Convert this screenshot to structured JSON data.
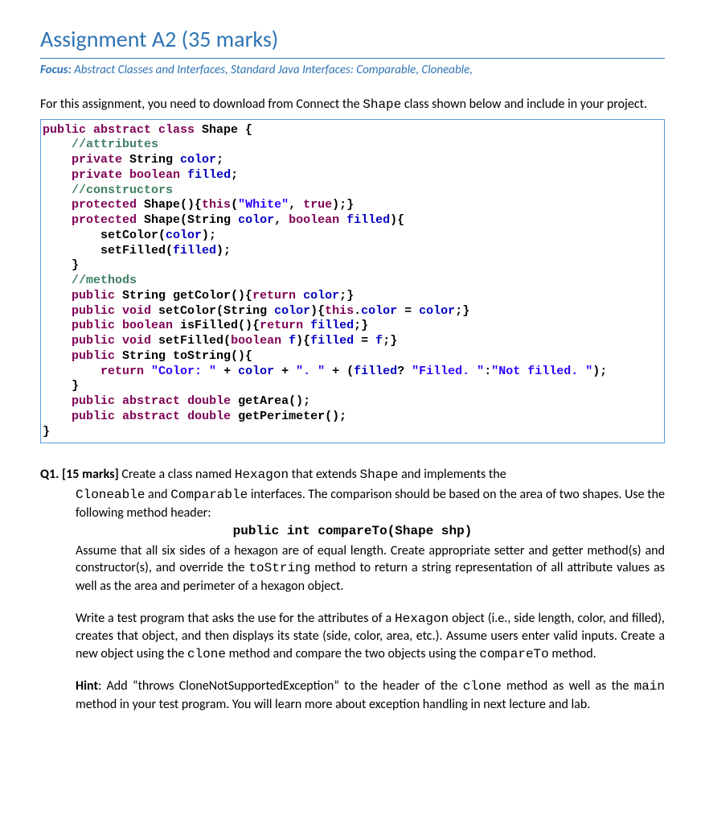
{
  "title": "Assignment A2 (35 marks)",
  "focus_label": "Focus:",
  "focus_text": " Abstract Classes and Interfaces, Standard Java Interfaces: Comparable, Cloneable,",
  "intro": {
    "pre": "For this assignment, you need to download from Connect the ",
    "code": "Shape",
    "post": " class shown below and include in your project."
  },
  "code": {
    "l01a": "public",
    "l01b": " abstract",
    "l01c": " class",
    "l01d": " Shape {",
    "l02": "    //attributes",
    "l03a": "    private",
    "l03b": " String ",
    "l03c": "color",
    "l03d": ";",
    "l04a": "    private",
    "l04b": " boolean",
    "l04c": " ",
    "l04d": "filled",
    "l04e": ";",
    "l05": "    //constructors",
    "l06a": "    protected",
    "l06b": " Shape(){",
    "l06c": "this",
    "l06d": "(",
    "l06e": "\"White\"",
    "l06f": ", ",
    "l06g": "true",
    "l06h": ");}",
    "l07a": "    protected",
    "l07b": " Shape(String ",
    "l07c": "color",
    "l07d": ", ",
    "l07e": "boolean",
    "l07f": " ",
    "l07g": "filled",
    "l07h": "){",
    "l08a": "        setColor(",
    "l08b": "color",
    "l08c": ");",
    "l09a": "        setFilled(",
    "l09b": "filled",
    "l09c": ");",
    "l10": "    }",
    "l11": "    //methods",
    "l12a": "    public",
    "l12b": " String getColor(){",
    "l12c": "return",
    "l12d": " ",
    "l12e": "color",
    "l12f": ";}",
    "l13a": "    public",
    "l13b": " ",
    "l13c": "void",
    "l13d": " setColor(String ",
    "l13e": "color",
    "l13f": "){",
    "l13g": "this",
    "l13h": ".",
    "l13i": "color",
    "l13j": " = ",
    "l13k": "color",
    "l13l": ";}",
    "l14a": "    public",
    "l14b": " ",
    "l14c": "boolean",
    "l14d": " isFilled(){",
    "l14e": "return",
    "l14f": " ",
    "l14g": "filled",
    "l14h": ";}",
    "l15a": "    public",
    "l15b": " ",
    "l15c": "void",
    "l15d": " setFilled(",
    "l15e": "boolean",
    "l15f": " ",
    "l15g": "f",
    "l15h": "){",
    "l15i": "filled",
    "l15j": " = ",
    "l15k": "f",
    "l15l": ";}",
    "l16a": "    public",
    "l16b": " String toString(){",
    "l17a": "        return",
    "l17b": " ",
    "l17c": "\"Color: \"",
    "l17d": " + ",
    "l17e": "color",
    "l17f": " + ",
    "l17g": "\". \"",
    "l17h": " + (",
    "l17i": "filled",
    "l17j": "? ",
    "l17k": "\"Filled. \"",
    "l17l": ":",
    "l17m": "\"Not filled. \"",
    "l17n": ");",
    "l18": "    }",
    "l19a": "    public",
    "l19b": " ",
    "l19c": "abstract",
    "l19d": " ",
    "l19e": "double",
    "l19f": " getArea();",
    "l20a": "    public",
    "l20b": " ",
    "l20c": "abstract",
    "l20d": " ",
    "l20e": "double",
    "l20f": " getPerimeter();",
    "l21": "}"
  },
  "q1": {
    "label": "Q1. [15 marks]",
    "head_1": " Create a class named ",
    "head_c1": "Hexagon",
    "head_2": " that extends ",
    "head_c2": "Shape",
    "head_3": " and implements the ",
    "sub_c1": "Cloneable",
    "sub_1": " and ",
    "sub_c2": "Comparable",
    "sub_2": " interfaces. The comparison should be based on the area of two shapes. Use the following method header:",
    "method": "public int compareTo(Shape shp)",
    "p2a": "Assume that all six sides of a hexagon are of equal length. Create appropriate setter and getter method(s) and constructor(s), and override the ",
    "p2c": "toString",
    "p2b": " method to return a string representation of all attribute values as well as the area and perimeter of a hexagon object.",
    "p3a": "Write a test program that asks the use for the attributes of a ",
    "p3c1": "Hexagon",
    "p3b": " object (i.e., side length, color, and filled), creates that object, and then displays its state (side, color, area, etc.). Assume users enter valid inputs. Create a new object using the ",
    "p3c2": "clone",
    "p3d": " method and compare the two objects using the ",
    "p3c3": "compareTo",
    "p3e": " method.",
    "hint_label": "Hint",
    "p4a": ": Add “throws CloneNotSupportedException”  to the header of the ",
    "p4c1": "clone",
    "p4b": " method as well as the ",
    "p4c2": "main",
    "p4c": " method in your test program. You will learn more about exception handling in next lecture and lab."
  }
}
